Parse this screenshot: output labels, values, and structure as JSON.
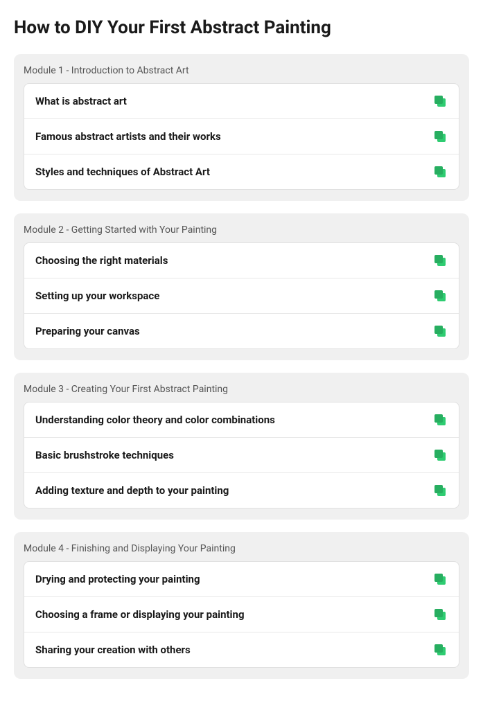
{
  "page": {
    "title": "How to DIY Your First Abstract Painting"
  },
  "modules": [
    {
      "id": "module-1",
      "label": "Module 1 - Introduction to Abstract Art",
      "lessons": [
        {
          "id": "lesson-1-1",
          "title": "What is abstract art"
        },
        {
          "id": "lesson-1-2",
          "title": "Famous abstract artists and their works"
        },
        {
          "id": "lesson-1-3",
          "title": "Styles and techniques of Abstract Art"
        }
      ]
    },
    {
      "id": "module-2",
      "label": "Module 2 - Getting Started with Your Painting",
      "lessons": [
        {
          "id": "lesson-2-1",
          "title": "Choosing the right materials"
        },
        {
          "id": "lesson-2-2",
          "title": "Setting up your workspace"
        },
        {
          "id": "lesson-2-3",
          "title": "Preparing your canvas"
        }
      ]
    },
    {
      "id": "module-3",
      "label": "Module 3 - Creating Your First Abstract Painting",
      "lessons": [
        {
          "id": "lesson-3-1",
          "title": "Understanding color theory and color combinations"
        },
        {
          "id": "lesson-3-2",
          "title": "Basic brushstroke techniques"
        },
        {
          "id": "lesson-3-3",
          "title": "Adding texture and depth to your painting"
        }
      ]
    },
    {
      "id": "module-4",
      "label": "Module 4 - Finishing and Displaying Your Painting",
      "lessons": [
        {
          "id": "lesson-4-1",
          "title": "Drying and protecting your painting"
        },
        {
          "id": "lesson-4-2",
          "title": "Choosing a frame or displaying your painting"
        },
        {
          "id": "lesson-4-3",
          "title": "Sharing your creation with others"
        }
      ]
    }
  ]
}
